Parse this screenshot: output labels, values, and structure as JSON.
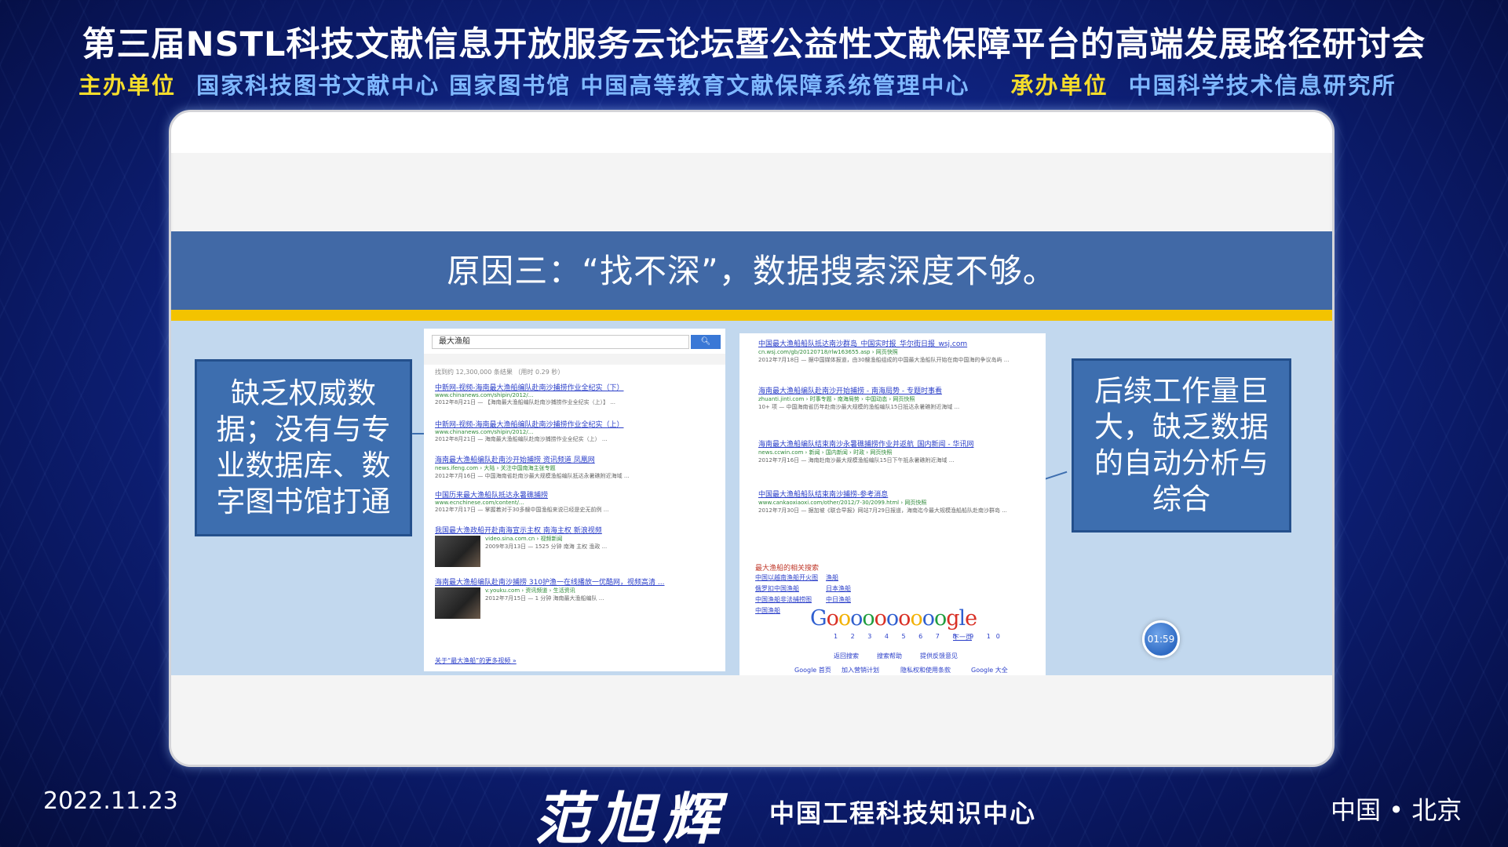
{
  "header": {
    "title": "第三届NSTL科技文献信息开放服务云论坛暨公益性文献保障平台的高端发展路径研讨会",
    "organizer_label": "主办单位",
    "organizers": "国家科技图书文献中心  国家图书馆  中国高等教育文献保障系统管理中心",
    "undertaker_label": "承办单位",
    "undertaker": "中国科学技术信息研究所"
  },
  "slide": {
    "heading": "原因三：“找不深”，数据搜索深度不够。",
    "callout_left": "缺乏权威数据；没有与专业数据库、数字图书馆打通",
    "callout_right": "后续工作量巨大，缺乏数据的自动分析与综合",
    "timer": "01:59"
  },
  "search_screenshot": {
    "query": "最大渔船",
    "search_button": "搜索",
    "result_count": "找到约 12,300,000 条结果 （用时 0.29 秒）",
    "results": [
      {
        "title": "中新网-视频-海南最大渔船编队赴南沙捕捞作业全纪实（下）",
        "url": "www.chinanews.com/shipin/2012/...",
        "desc": "2012年8月21日 — 【海南最大渔船编队赴南沙捕捞作业全纪实（上）】 ..."
      },
      {
        "title": "中新网-视频-海南最大渔船编队赴南沙捕捞作业全纪实（上）",
        "url": "www.chinanews.com/shipin/2012/...",
        "desc": "2012年8月21日 — 海南最大渔船编队赴南沙捕捞作业全纪实（上） ..."
      },
      {
        "title": "海南最大渔船编队赴南沙开始捕捞 资讯频道 凤凰网",
        "url": "news.ifeng.com › 大陆 › 关注中国南海主张专题",
        "desc": "2012年7月16日 — 中国海南省赴南沙最大规模渔船编队抵达永暑礁附近海域 ..."
      },
      {
        "title": "中国历来最大渔船队抵达永暑礁捕捞",
        "url": "www.ecnchinese.com/content/...",
        "desc": "2012年7月17日 — 掌握着对于30多艘中国渔船来说已经是史无前例 ..."
      },
      {
        "title": "我国最大渔政船开赴南海宣示主权 南海主权 新浪视频",
        "url": "video.sina.com.cn › 视频新闻",
        "desc": "2009年3月13日 — 1525 分钟 南海 主权 渔政 ..."
      },
      {
        "title": "海南最大渔船编队赴南沙捕捞 310护渔一在线播放一优酷网，视频高清 ...",
        "url": "v.youku.com › 资讯频道 › 生活资讯",
        "desc": "2012年7月15日 — 1 分钟 海南最大渔船编队 ..."
      }
    ],
    "more_videos": "关于“最大渔船”的更多视频 »"
  },
  "results_screenshot": {
    "results": [
      {
        "title": "中国最大渔船船队抵达南沙群岛_中国实时报_华尔街日报_wsj.com",
        "url": "cn.wsj.com/gb/20120718/rlw163655.asp › 网页快照",
        "desc": "2012年7月18日 — 据中国媒体报道，由30艘渔船组成的中国最大渔船队开始在南中国海的争议岛屿 ..."
      },
      {
        "title": "海南最大渔船编队赴南沙开始捕捞 - 南海局势 - 专题时事看",
        "url": "zhuanti.jinti.com › 时事专题 › 南海局势 › 中国动态 › 网页快照",
        "desc": "10+ 项 — 中国海南省历年赴南沙最大规模的渔船编队15日抵达永暑礁附近海域 ..."
      },
      {
        "title": "海南最大渔船编队结束南沙永暑礁捕捞作业并返航_国内新闻 - 华讯网",
        "url": "news.ccwin.com › 新闻 › 国内新闻 › 时政 › 网页快照",
        "desc": "2012年7月16日 — 海南赴南沙最大规模渔船编队15日下午抵永暑礁附近海域 ..."
      },
      {
        "title": "中国最大渔船船队结束南沙捕捞-参考消息",
        "url": "www.cankaoxiaoxi.com/other/2012/7-30/2099.html › 网页快照",
        "desc": "2012年7月30日 — 据加坡《联合早报》网站7月29日报道，海南迄今最大规模渔船船队赴南沙群岛 ..."
      }
    ],
    "related_title": "最大渔船的相关搜索",
    "related": [
      "中国以越南渔船开火图",
      "渔船",
      "俄罗扣中国渔船",
      "日本渔船",
      "中国渔船非法捕捞图",
      "中日渔船",
      "中国渔船"
    ],
    "logo": "Goooooooooogle",
    "pages": "1 2 3 4 5 6 7 8 9 10",
    "next": "下一页",
    "footer1": [
      "返回搜索",
      "搜索帮助",
      "提供反馈意见"
    ],
    "footer2": [
      "Google 首页",
      "加入营销计划",
      "隐私权和使用条款",
      "Google 大全"
    ]
  },
  "footer": {
    "date": "2022.11.23",
    "speaker": "范旭辉",
    "organization": "中国工程科技知识中心",
    "location": "中国 • 北京"
  },
  "colors": {
    "background": "#0f2380",
    "organizer_label": "#f6dd2b",
    "organizer_value": "#7fb8ff",
    "slide_band": "#4169a6",
    "slide_stripe": "#f3c300",
    "callout": "#3d6eaf",
    "slide_content_bg": "#c2d8ee"
  }
}
